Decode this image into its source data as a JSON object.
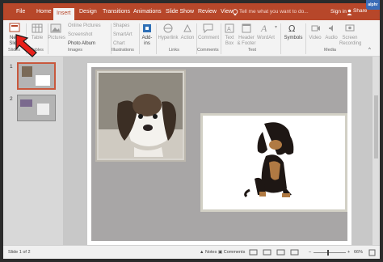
{
  "app": {
    "name": "PowerPoint",
    "watermark": "alphr"
  },
  "tabs": [
    {
      "label": "File",
      "active": false
    },
    {
      "label": "Home",
      "active": false
    },
    {
      "label": "Insert",
      "active": true
    },
    {
      "label": "Design",
      "active": false
    },
    {
      "label": "Transitions",
      "active": false
    },
    {
      "label": "Animations",
      "active": false
    },
    {
      "label": "Slide Show",
      "active": false
    },
    {
      "label": "Review",
      "active": false
    },
    {
      "label": "View",
      "active": false
    }
  ],
  "tell_me": "Tell me what you want to do...",
  "sign_in": "Sign in",
  "share": "Share",
  "ribbon": {
    "new_slide": "New Slide",
    "table": "Table",
    "pictures": "Pictures",
    "online_pictures": "Online Pictures",
    "screenshot": "Screenshot",
    "photo_album": "Photo Album",
    "shapes": "Shapes",
    "smartart": "SmartArt",
    "chart": "Chart",
    "addins": "Add-ins",
    "hyperlink": "Hyperlink",
    "action": "Action",
    "comment": "Comment",
    "text_box": "Text Box",
    "header_footer": "Header & Footer",
    "wordart": "WordArt",
    "symbols": "Symbols",
    "video": "Video",
    "audio": "Audio",
    "screen_recording": "Screen Recording",
    "groups": {
      "slides": "Slides",
      "tables": "Tables",
      "images": "Images",
      "illustrations": "Illustrations",
      "links": "Links",
      "comments": "Comments",
      "text": "Text",
      "media": "Media"
    }
  },
  "thumbnails": [
    {
      "number": "1"
    },
    {
      "number": "2"
    }
  ],
  "status": {
    "slide_of": "Slide 1 of 2",
    "notes": "Notes",
    "comments": "Comments",
    "zoom_minus": "–",
    "zoom_plus": "+",
    "zoom": "66%"
  },
  "colors": {
    "accent": "#b7472a",
    "arrow": "#e8211b"
  }
}
